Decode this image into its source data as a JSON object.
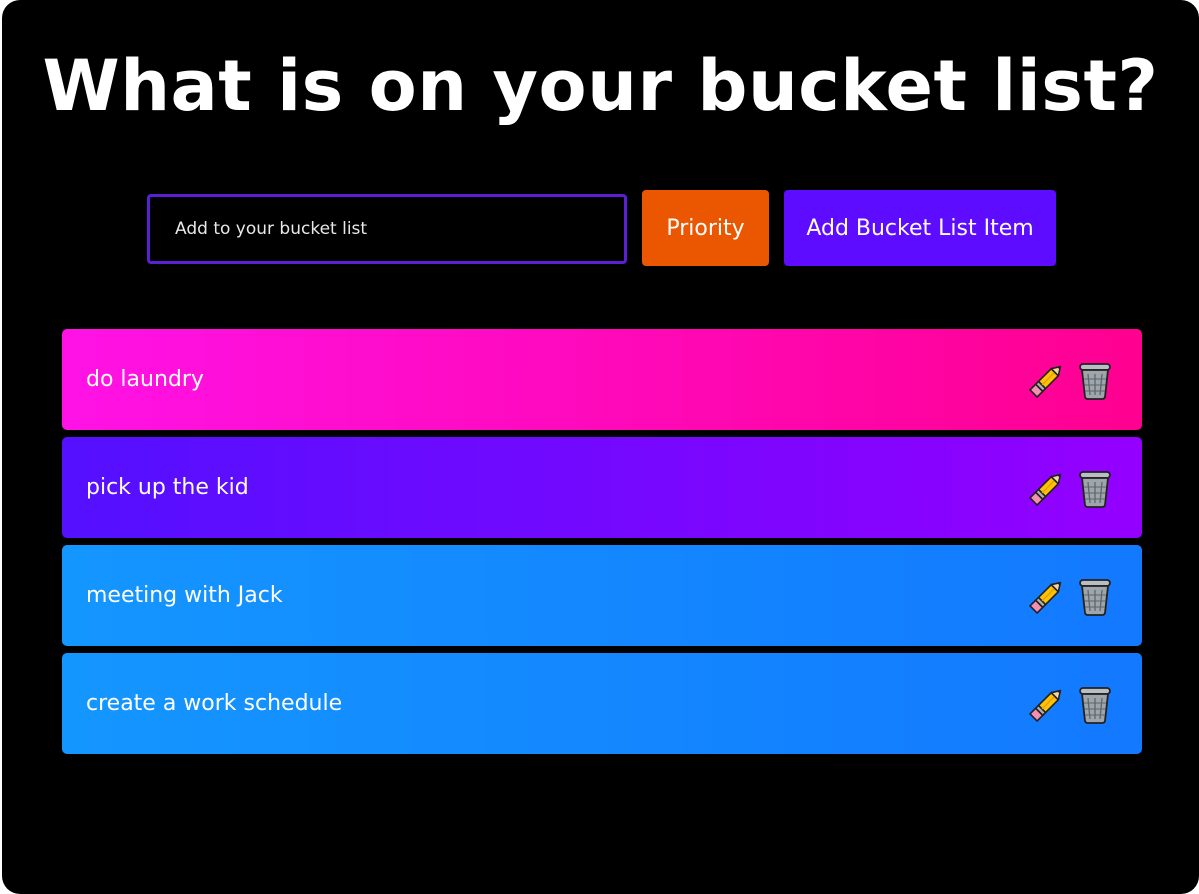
{
  "header": {
    "title": "What is on your bucket list?"
  },
  "form": {
    "input_placeholder": "Add to your bucket list",
    "input_value": "",
    "priority_label": "Priority",
    "add_label": "Add Bucket List Item"
  },
  "items": [
    {
      "text": "do laundry",
      "gradient_start": "#ff12e6",
      "gradient_end": "#ff0090"
    },
    {
      "text": "pick up the kid",
      "gradient_start": "#5410ff",
      "gradient_end": "#9400ff"
    },
    {
      "text": "meeting with Jack",
      "gradient_start": "#1496ff",
      "gradient_end": "#1379ff"
    },
    {
      "text": "create a work schedule",
      "gradient_start": "#1496ff",
      "gradient_end": "#1379ff"
    }
  ],
  "icons": {
    "edit": "pencil-icon",
    "delete": "trash-can-icon"
  },
  "colors": {
    "background": "#000000",
    "input_border": "#5b1fd6",
    "priority_button": "#eb5600",
    "add_button": "#5d0cff"
  }
}
